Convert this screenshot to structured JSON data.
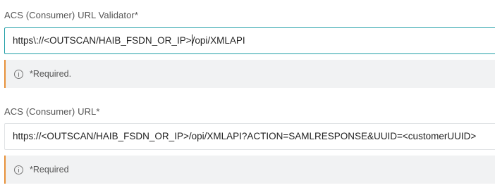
{
  "fields": [
    {
      "label": "ACS (Consumer) URL Validator*",
      "value_before_caret": "https\\://<OUTSCAN/HAIB_FSDN_OR_IP>",
      "value_after_caret": "/opi/XMLAPI",
      "hint": "*Required."
    },
    {
      "label": "ACS (Consumer) URL*",
      "value": "https://<OUTSCAN/HAIB_FSDN_OR_IP>/opi/XMLAPI?ACTION=SAMLRESPONSE&UUID=<customerUUID>",
      "hint": "*Required"
    }
  ],
  "colors": {
    "focus_border": "#23a0a8",
    "warning_accent": "#e7913a",
    "hint_background": "#f1f2f3"
  },
  "icons": [
    "info-icon"
  ]
}
